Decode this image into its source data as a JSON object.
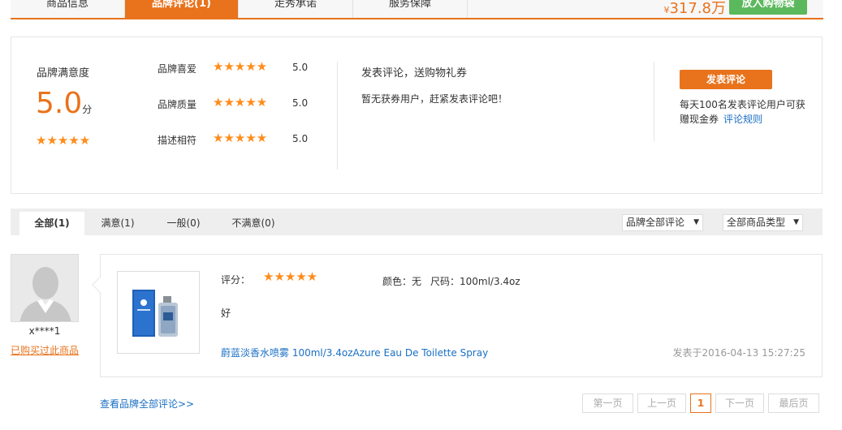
{
  "top_tabs": [
    {
      "label": "商品信息"
    },
    {
      "label": "品牌评论(1)"
    },
    {
      "label": "走秀承诺"
    },
    {
      "label": "服务保障"
    }
  ],
  "price": {
    "symbol": "¥",
    "value": "317.8万"
  },
  "cart_button": "放入购物袋",
  "summary": {
    "title": "品牌满意度",
    "score": "5.0",
    "unit": "分",
    "stars": 5,
    "metrics": [
      {
        "label": "品牌喜爱",
        "value": "5.0"
      },
      {
        "label": "品牌质量",
        "value": "5.0"
      },
      {
        "label": "描述相符",
        "value": "5.0"
      }
    ]
  },
  "promo": {
    "title": "发表评论，送购物礼券",
    "text": "暂无获券用户，赶紧发表评论吧！"
  },
  "review_button": "发表评论",
  "promo_note": "每天100名发表评论用户可获赠现金券",
  "rule_link": "评论规则",
  "filters": [
    {
      "label": "全部(1)"
    },
    {
      "label": "满意(1)"
    },
    {
      "label": "一般(0)"
    },
    {
      "label": "不满意(0)"
    }
  ],
  "selects": {
    "comments": "品牌全部评论",
    "types": "全部商品类型"
  },
  "review": {
    "user": "x****1",
    "bought": "已购买过此商品",
    "score_label": "评分：",
    "stars": 5,
    "color": "颜色：无",
    "size": "尺码：100ml/3.4oz",
    "comment": "好",
    "product": "蔚蓝淡香水喷雾 100ml/3.4ozAzure Eau De Toilette Spray",
    "posted": "发表于2016-04-13 15:27:25"
  },
  "view_all": "查看品牌全部评论>>",
  "pagination": {
    "first": "第一页",
    "prev": "上一页",
    "current": "1",
    "next": "下一页",
    "last": "最后页"
  },
  "colors": {
    "accent": "#e8731c",
    "cart": "#5cb85c",
    "link": "#1a6fc4",
    "star": "#ff8c1a"
  },
  "icons": {
    "star": "star-icon",
    "caret": "caret-down-icon",
    "avatar": "avatar-placeholder",
    "product": "perfume-bottle"
  }
}
